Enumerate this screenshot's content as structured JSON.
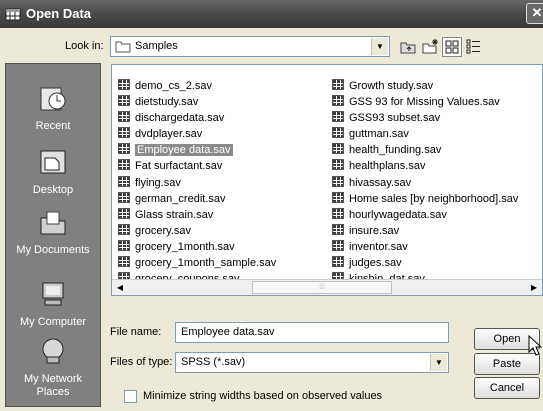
{
  "window": {
    "title": "Open Data",
    "close_label": "✕"
  },
  "toolbar": {
    "lookin_label": "Look in:",
    "lookin_value": "Samples",
    "buttons": [
      "up-folder-icon",
      "new-folder-icon",
      "list-view-icon",
      "details-view-icon"
    ]
  },
  "places": [
    {
      "label": "Recent",
      "icon": "recent-icon"
    },
    {
      "label": "Desktop",
      "icon": "desktop-icon"
    },
    {
      "label": "My Documents",
      "icon": "my-documents-icon"
    },
    {
      "label": "My Computer",
      "icon": "my-computer-icon"
    },
    {
      "label": "My Network Places",
      "icon": "network-icon"
    }
  ],
  "files": {
    "selected": "Employee data.sav",
    "left": [
      "demo_cs_2.sav",
      "dietstudy.sav",
      "dischargedata.sav",
      "dvdplayer.sav",
      "Employee data.sav",
      "Fat surfactant.sav",
      "flying.sav",
      "german_credit.sav",
      "Glass strain.sav",
      "grocery.sav",
      "grocery_1month.sav",
      "grocery_1month_sample.sav",
      "grocery_coupons.sav"
    ],
    "right": [
      "Growth study.sav",
      "GSS 93 for Missing Values.sav",
      "GSS93 subset.sav",
      "guttman.sav",
      "health_funding.sav",
      "healthplans.sav",
      "hivassay.sav",
      "Home sales [by neighborhood].sav",
      "hourlywagedata.sav",
      "insure.sav",
      "inventor.sav",
      "judges.sav",
      "kinship_dat.sav"
    ]
  },
  "form": {
    "filename_label": "File name:",
    "filename_value": "Employee data.sav",
    "filetype_label": "Files of type:",
    "filetype_value": "SPSS (*.sav)",
    "checkbox_label": "Minimize string widths based on observed values",
    "checkbox_checked": false
  },
  "buttons": {
    "open": "Open",
    "paste": "Paste",
    "cancel": "Cancel"
  }
}
